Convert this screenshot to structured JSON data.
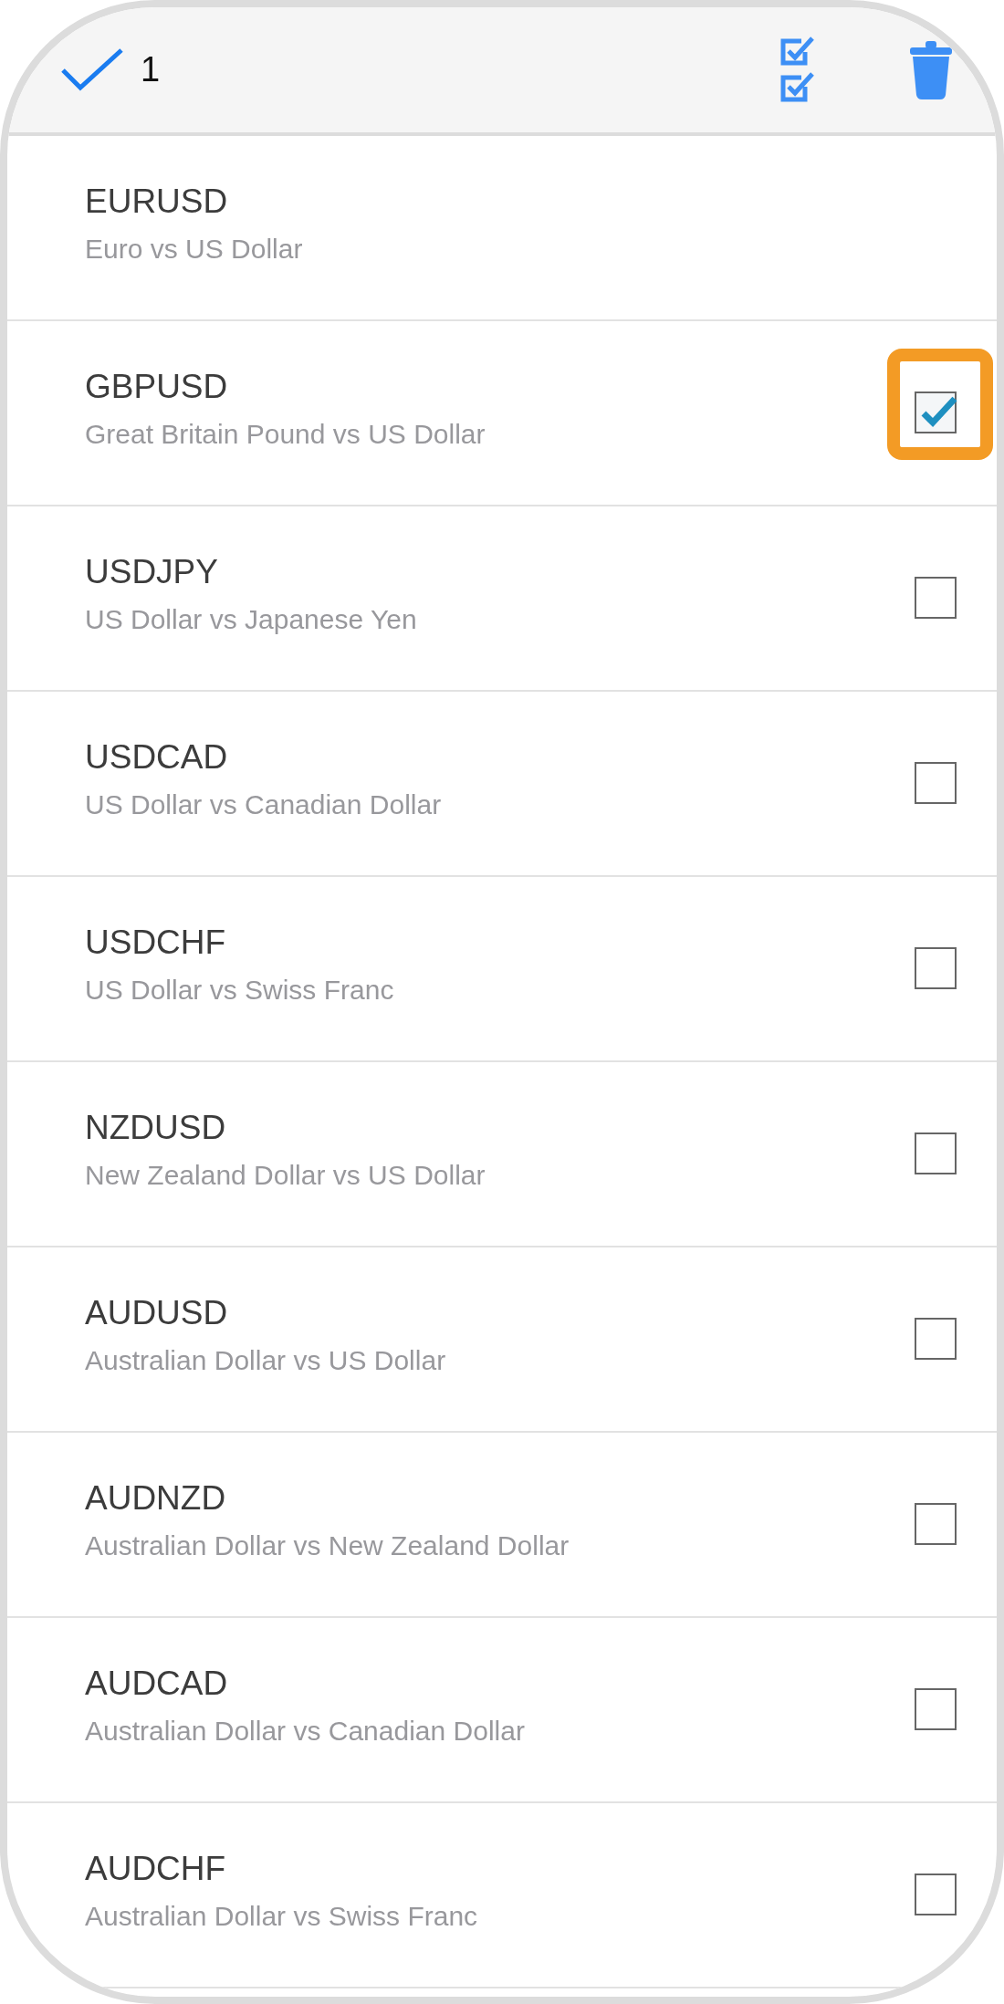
{
  "header": {
    "selected_count": "1"
  },
  "symbols": [
    {
      "kind": "fixed",
      "symbol": "EURUSD",
      "description": "Euro vs US Dollar"
    },
    {
      "kind": "checkbox",
      "symbol": "GBPUSD",
      "description": "Great Britain Pound vs US Dollar",
      "checked": true,
      "highlighted": true
    },
    {
      "kind": "checkbox",
      "symbol": "USDJPY",
      "description": "US Dollar vs Japanese Yen",
      "checked": false,
      "highlighted": false
    },
    {
      "kind": "checkbox",
      "symbol": "USDCAD",
      "description": "US Dollar vs Canadian Dollar",
      "checked": false,
      "highlighted": false
    },
    {
      "kind": "checkbox",
      "symbol": "USDCHF",
      "description": "US Dollar vs Swiss Franc",
      "checked": false,
      "highlighted": false
    },
    {
      "kind": "checkbox",
      "symbol": "NZDUSD",
      "description": "New Zealand Dollar vs US Dollar",
      "checked": false,
      "highlighted": false
    },
    {
      "kind": "checkbox",
      "symbol": "AUDUSD",
      "description": "Australian Dollar vs US Dollar",
      "checked": false,
      "highlighted": false
    },
    {
      "kind": "checkbox",
      "symbol": "AUDNZD",
      "description": "Australian Dollar vs New Zealand Dollar",
      "checked": false,
      "highlighted": false
    },
    {
      "kind": "checkbox",
      "symbol": "AUDCAD",
      "description": "Australian Dollar vs Canadian Dollar",
      "checked": false,
      "highlighted": false
    },
    {
      "kind": "checkbox",
      "symbol": "AUDCHF",
      "description": "Australian Dollar vs Swiss Franc",
      "checked": false,
      "highlighted": false
    }
  ]
}
